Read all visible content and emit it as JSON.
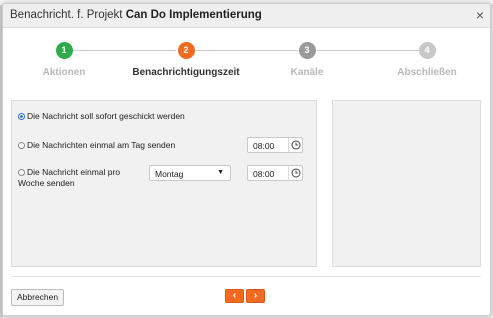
{
  "dialog": {
    "title_prefix": "Benachricht. f. Projekt ",
    "project_name": "Can Do Implementierung",
    "close_label": "×"
  },
  "stepper": {
    "steps": [
      {
        "number": "1",
        "label": "Aktionen",
        "state": "done",
        "color": "#2eac4a"
      },
      {
        "number": "2",
        "label": "Benachrichtigungszeit",
        "state": "active",
        "color": "#f36b21"
      },
      {
        "number": "3",
        "label": "Kanäle",
        "state": "pending",
        "color": "#9a9a9a"
      },
      {
        "number": "4",
        "label": "Abschließen",
        "state": "pending",
        "color": "#c8c8c8"
      }
    ]
  },
  "options": {
    "immediate": {
      "label": "Die Nachricht soll sofort geschickt werden",
      "selected": true
    },
    "daily": {
      "label": "Die Nachrichten einmal am Tag senden",
      "selected": false,
      "time": "08:00"
    },
    "weekly": {
      "label_line1": "Die Nachricht einmal pro",
      "label_line2": "Woche senden",
      "selected": false,
      "weekday": "Montag",
      "time": "08:00"
    }
  },
  "footer": {
    "cancel_label": "Abbrechen",
    "prev_label": "‹",
    "next_label": "›"
  },
  "colors": {
    "accent": "#f36b21",
    "done": "#2eac4a",
    "radio_selected": "#2b6fd6"
  }
}
